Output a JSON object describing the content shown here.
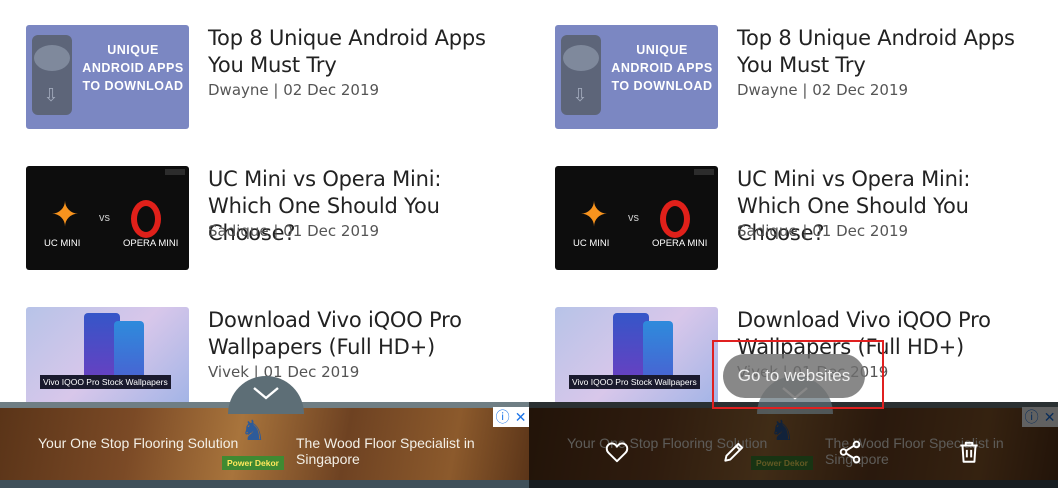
{
  "articles": [
    {
      "title": "Top 8 Unique Android Apps You Must Try",
      "meta": "Dwayne | 02 Dec 2019",
      "thumb_text": "UNIQUE ANDROID APPS TO DOWNLOAD"
    },
    {
      "title": "UC Mini vs Opera Mini: Which One Should You Choose?",
      "meta": "Sadique | 01 Dec 2019",
      "thumb_left": "UC MINI",
      "thumb_vs": "vs",
      "thumb_right": "OPERA MINI"
    },
    {
      "title": "Download Vivo iQOO Pro Wallpapers (Full HD+)",
      "meta": "Vivek | 01 Dec 2019",
      "thumb_caption": "Vivo IQOO Pro Stock Wallpapers"
    }
  ],
  "ad": {
    "left_text": "Your One Stop Flooring Solution",
    "right_text": "The Wood Floor Specialist in Singapore",
    "brand": "Power Dekor"
  },
  "overlay": {
    "go_to_websites": "Go to websites"
  },
  "icons": {
    "collapse": "chevron-down-icon",
    "like": "heart-icon",
    "edit": "pencil-icon",
    "share": "share-icon",
    "delete": "trash-icon",
    "ad_info": "info-icon",
    "ad_close": "close-icon"
  },
  "colors": {
    "highlight": "#e02020",
    "title_text": "#222222",
    "meta_text": "#555555"
  }
}
